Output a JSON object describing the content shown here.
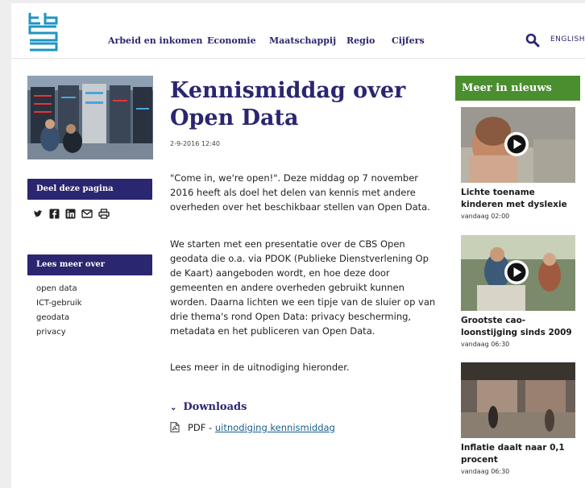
{
  "header": {
    "nav": [
      "Arbeid en inkomen",
      "Economie",
      "Maatschappij",
      "Regio",
      "Cijfers"
    ],
    "language": "ENGLISH"
  },
  "sidebar": {
    "share_heading": "Deel deze pagina",
    "share_icons": [
      "twitter-icon",
      "facebook-icon",
      "linkedin-icon",
      "mail-icon",
      "print-icon"
    ],
    "more_heading": "Lees meer over",
    "tags": [
      "open data",
      "ICT-gebruik",
      "geodata",
      "privacy"
    ]
  },
  "article": {
    "title": "Kennismiddag over Open Data",
    "date": "2-9-2016 12:40",
    "paragraphs": [
      "\"Come in, we're open!\". Deze middag op 7 november 2016 heeft als doel het delen van kennis met andere overheden over het beschikbaar stellen van Open Data.",
      "We starten met een presentatie over de CBS Open geodata die o.a. via PDOK (Publieke Dienstverlening Op de Kaart) aangeboden wordt, en hoe deze door gemeenten en andere overheden gebruikt kunnen worden. Daarna lichten we een tipje van de sluier op van drie thema's rond Open Data: privacy bescherming, metadata en het publiceren van Open Data.",
      "Lees meer in de uitnodiging hieronder."
    ],
    "downloads_heading": "Downloads",
    "download": {
      "type": "PDF - ",
      "link": "uitnodiging kennismiddag"
    }
  },
  "news": {
    "heading": "Meer in nieuws",
    "items": [
      {
        "title": "Lichte toename kinderen met dyslexie",
        "time": "vandaag 02:00"
      },
      {
        "title": "Grootste cao-loonstijging sinds 2009",
        "time": "vandaag 06:30"
      },
      {
        "title": "Inflatie daalt naar 0,1 procent",
        "time": "vandaag 06:30"
      }
    ]
  },
  "colors": {
    "brand": "#2a2670",
    "news_green": "#4a8e2f",
    "link": "#1a5f8c",
    "logo": "#1d95c5"
  }
}
